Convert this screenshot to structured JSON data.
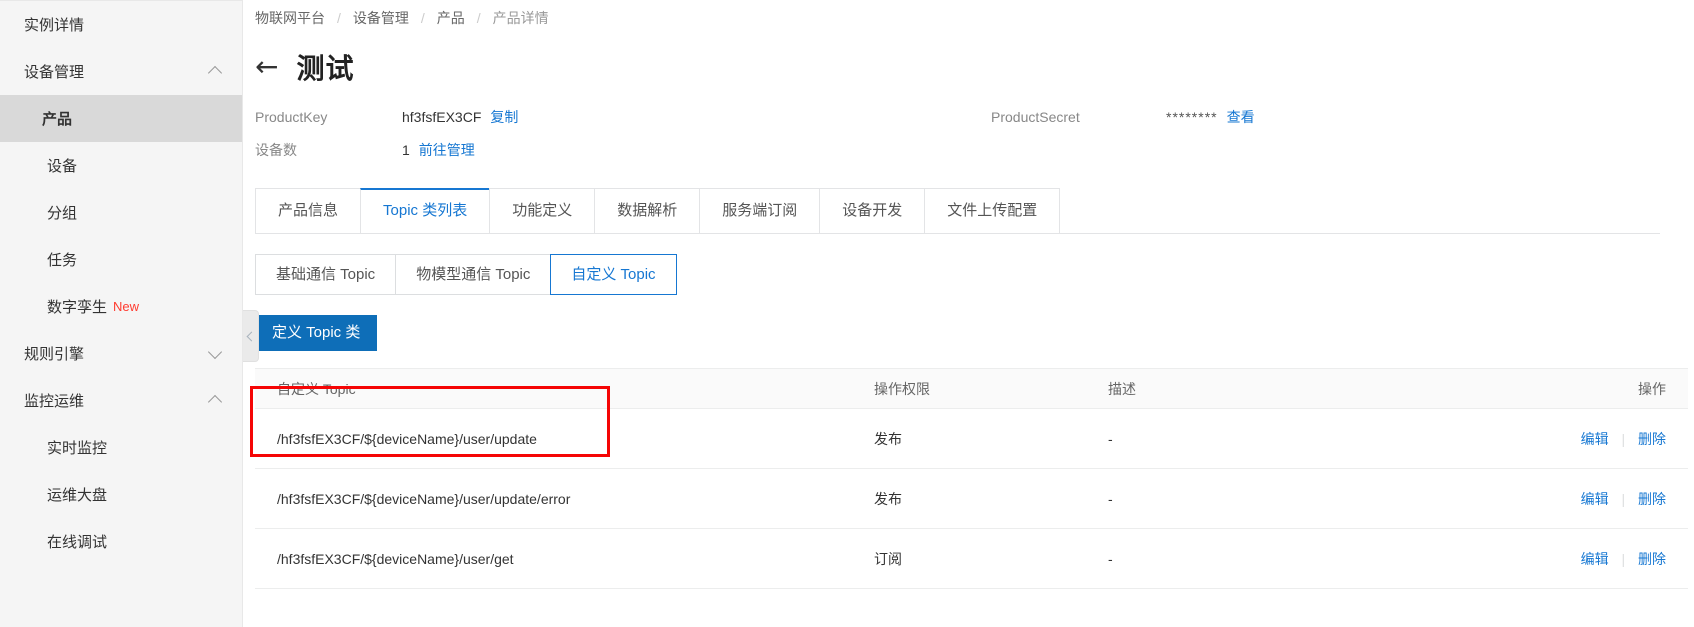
{
  "sidebar": {
    "items": [
      {
        "label": "实例详情",
        "type": "top",
        "icon": null
      },
      {
        "label": "设备管理",
        "type": "top",
        "icon": "chevron-up-icon"
      },
      {
        "label": "产品",
        "type": "sub",
        "active": true
      },
      {
        "label": "设备",
        "type": "sub",
        "active": false
      },
      {
        "label": "分组",
        "type": "sub",
        "active": false
      },
      {
        "label": "任务",
        "type": "sub",
        "active": false
      },
      {
        "label": "数字孪生",
        "type": "sub",
        "active": false,
        "badge": "New"
      },
      {
        "label": "规则引擎",
        "type": "top",
        "icon": "chevron-down-icon"
      },
      {
        "label": "监控运维",
        "type": "top",
        "icon": "chevron-up-icon"
      },
      {
        "label": "实时监控",
        "type": "sub",
        "active": false
      },
      {
        "label": "运维大盘",
        "type": "sub",
        "active": false
      },
      {
        "label": "在线调试",
        "type": "sub",
        "active": false
      }
    ],
    "collapse_handle_icon": "chevron-left-icon"
  },
  "breadcrumb": {
    "items": [
      "物联网平台",
      "设备管理",
      "产品",
      "产品详情"
    ],
    "separator": "/"
  },
  "header": {
    "back_icon": "arrow-left-icon",
    "title": "测试"
  },
  "info": {
    "product_key_label": "ProductKey",
    "product_key_value": "hf3fsfEX3CF",
    "product_key_action": "复制",
    "device_count_label": "设备数",
    "device_count_value": "1",
    "device_count_action": "前往管理",
    "product_secret_label": "ProductSecret",
    "product_secret_value": "********",
    "product_secret_action": "查看"
  },
  "tabs": [
    {
      "label": "产品信息",
      "active": false
    },
    {
      "label": "Topic 类列表",
      "active": true
    },
    {
      "label": "功能定义",
      "active": false
    },
    {
      "label": "数据解析",
      "active": false
    },
    {
      "label": "服务端订阅",
      "active": false
    },
    {
      "label": "设备开发",
      "active": false
    },
    {
      "label": "文件上传配置",
      "active": false
    }
  ],
  "subtabs": [
    {
      "label": "基础通信 Topic",
      "active": false
    },
    {
      "label": "物模型通信 Topic",
      "active": false
    },
    {
      "label": "自定义 Topic",
      "active": true
    }
  ],
  "actions": {
    "define_topic_button": "定义 Topic 类"
  },
  "table": {
    "columns": [
      "自定义 Topic",
      "操作权限",
      "描述",
      "操作"
    ],
    "rows": [
      {
        "topic": "/hf3fsfEX3CF/${deviceName}/user/update",
        "permission": "发布",
        "description": "-",
        "edit": "编辑",
        "delete": "删除",
        "highlighted": true
      },
      {
        "topic": "/hf3fsfEX3CF/${deviceName}/user/update/error",
        "permission": "发布",
        "description": "-",
        "edit": "编辑",
        "delete": "删除",
        "highlighted": false
      },
      {
        "topic": "/hf3fsfEX3CF/${deviceName}/user/get",
        "permission": "订阅",
        "description": "-",
        "edit": "编辑",
        "delete": "删除",
        "highlighted": false
      }
    ]
  },
  "colors": {
    "link": "#1677d2",
    "primary_button": "#0e6eb8",
    "badge_new": "#ff3b30",
    "highlight_outline": "#f50505",
    "sidebar_bg": "#f5f5f5",
    "sidebar_active_bg": "#d9d9d9"
  }
}
